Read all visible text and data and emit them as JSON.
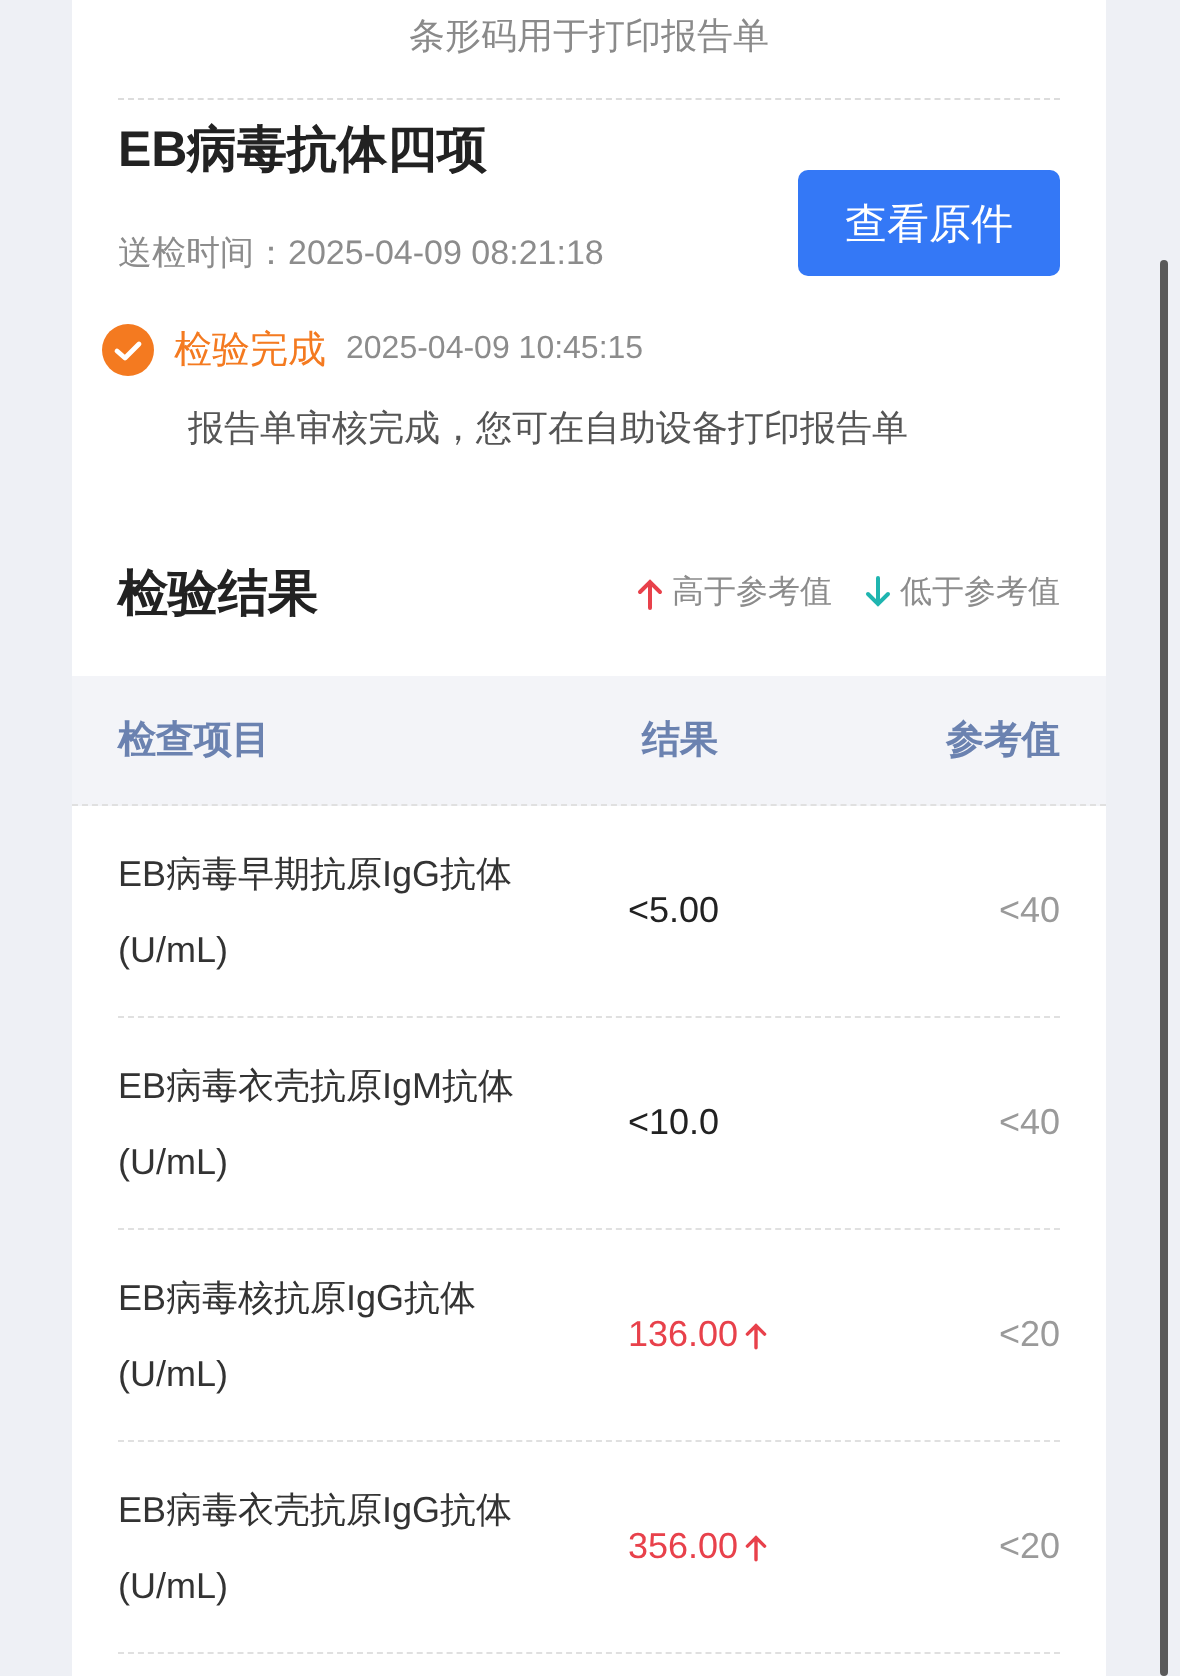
{
  "barcode_caption": "条形码用于打印报告单",
  "report": {
    "title": "EB病毒抗体四项",
    "submit_label": "送检时间：",
    "submit_time": "2025-04-09 08:21:18",
    "view_button": "查看原件"
  },
  "status": {
    "done": true,
    "label": "检验完成",
    "time": "2025-04-09 10:45:15",
    "message": "报告单审核完成，您可在自助设备打印报告单"
  },
  "results": {
    "title": "检验结果",
    "legend": [
      {
        "kind": "high",
        "label": "高于参考值"
      },
      {
        "kind": "low",
        "label": "低于参考值"
      }
    ],
    "columns": [
      "检查项目",
      "结果",
      "参考值"
    ],
    "rows": [
      {
        "name": "EB病毒早期抗原IgG抗体",
        "unit": "(U/mL)",
        "value": "<5.00",
        "high": false,
        "reference": "<40"
      },
      {
        "name": "EB病毒衣壳抗原IgM抗体",
        "unit": "(U/mL)",
        "value": "<10.0",
        "high": false,
        "reference": "<40"
      },
      {
        "name": "EB病毒核抗原IgG抗体",
        "unit": "(U/mL)",
        "value": "136.00",
        "high": true,
        "reference": "<20"
      },
      {
        "name": "EB病毒衣壳抗原IgG抗体",
        "unit": "(U/mL)",
        "value": "356.00",
        "high": true,
        "reference": "<20"
      }
    ]
  }
}
